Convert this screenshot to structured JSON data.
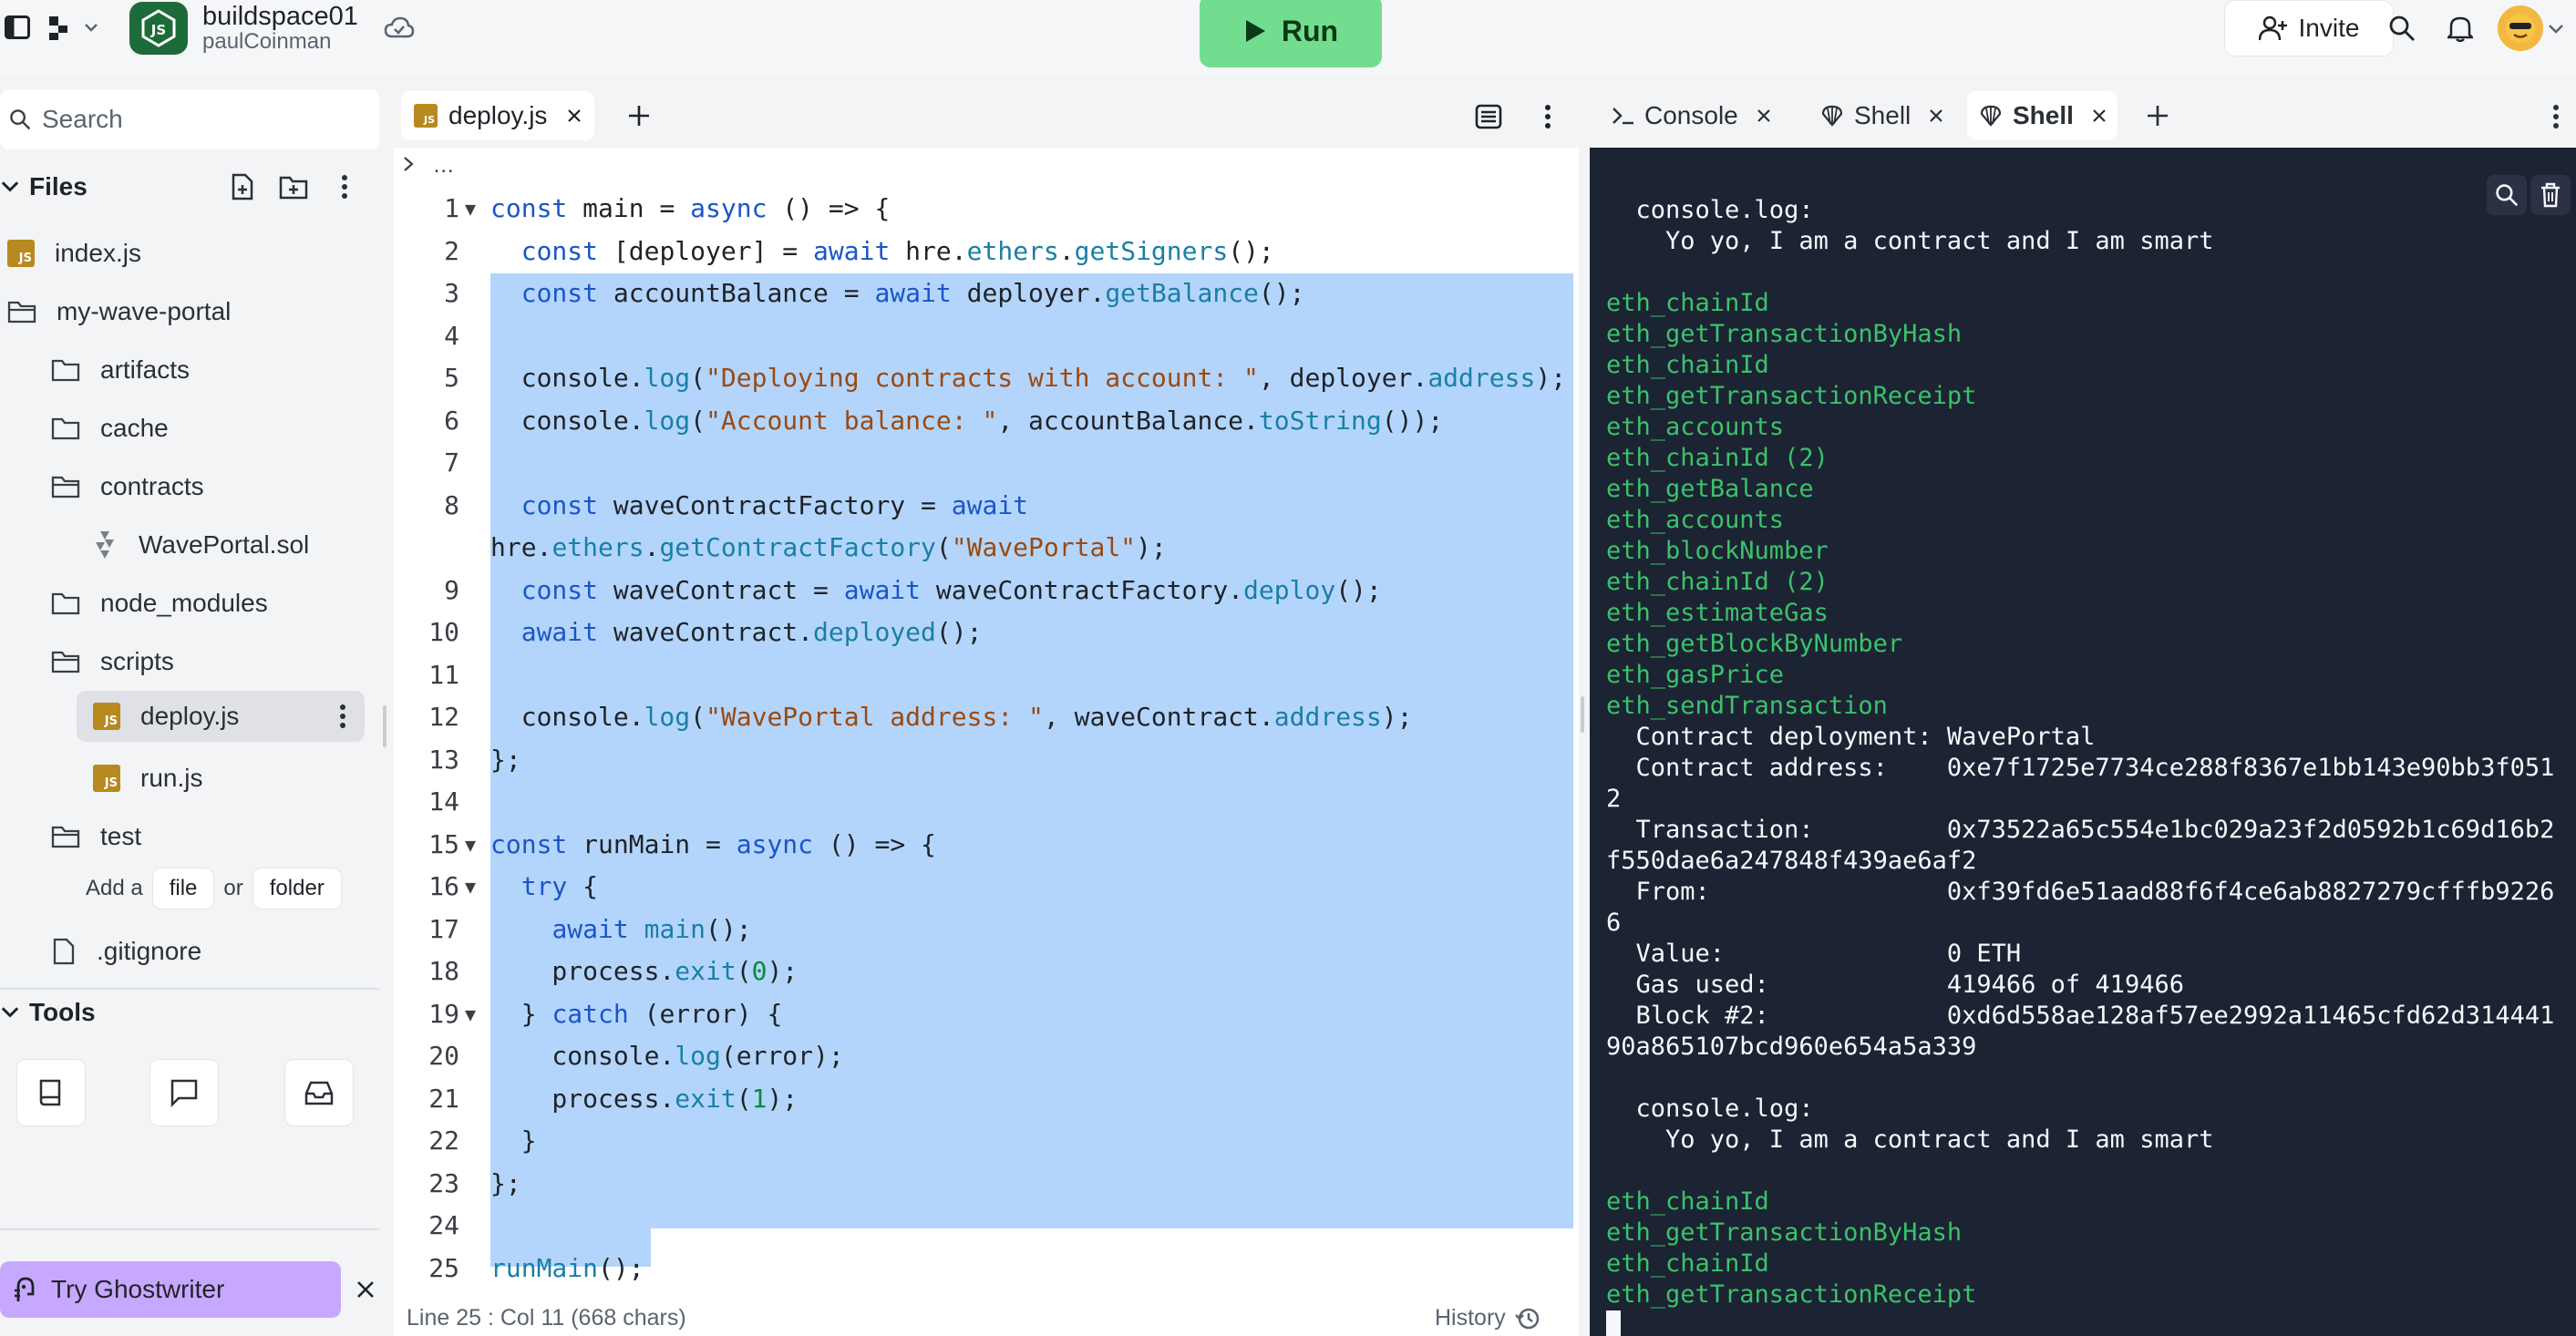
{
  "topbar": {
    "repl_name": "buildspace01",
    "owner": "paulCoinman",
    "run_label": "Run",
    "invite_label": "Invite"
  },
  "sidebar": {
    "search_placeholder": "Search",
    "files_label": "Files",
    "items": [
      {
        "label": "index.js",
        "type": "js"
      },
      {
        "label": "my-wave-portal",
        "type": "folder"
      },
      {
        "label": "artifacts",
        "type": "folder"
      },
      {
        "label": "cache",
        "type": "folder"
      },
      {
        "label": "contracts",
        "type": "folder"
      },
      {
        "label": "WavePortal.sol",
        "type": "sol"
      },
      {
        "label": "node_modules",
        "type": "folder"
      },
      {
        "label": "scripts",
        "type": "folder"
      },
      {
        "label": "deploy.js",
        "type": "js"
      },
      {
        "label": "run.js",
        "type": "js"
      },
      {
        "label": "test",
        "type": "folder"
      },
      {
        "label": ".gitignore",
        "type": "file"
      }
    ],
    "add_prefix": "Add a",
    "add_file": "file",
    "add_or": "or",
    "add_folder": "folder",
    "tools_label": "Tools",
    "ghostwriter_label": "Try Ghostwriter"
  },
  "editor": {
    "tab_label": "deploy.js",
    "breadcrumb": "…",
    "status_left": "Line 25 : Col 11 (668 chars)",
    "status_right": "History",
    "lines": [
      {
        "n": "1",
        "fold": "▼",
        "text": "const main = async () => {"
      },
      {
        "n": "2",
        "fold": "",
        "text": "  const [deployer] = await hre.ethers.getSigners();"
      },
      {
        "n": "3",
        "fold": "",
        "text": "  const accountBalance = await deployer.getBalance();"
      },
      {
        "n": "4",
        "fold": "",
        "text": ""
      },
      {
        "n": "5",
        "fold": "",
        "text": "  console.log(\"Deploying contracts with account: \", deployer.address);"
      },
      {
        "n": "6",
        "fold": "",
        "text": "  console.log(\"Account balance: \", accountBalance.toString());"
      },
      {
        "n": "7",
        "fold": "",
        "text": ""
      },
      {
        "n": "8",
        "fold": "",
        "text": "  const waveContractFactory = await"
      },
      {
        "n": "",
        "fold": "",
        "text": "hre.ethers.getContractFactory(\"WavePortal\");"
      },
      {
        "n": "9",
        "fold": "",
        "text": "  const waveContract = await waveContractFactory.deploy();"
      },
      {
        "n": "10",
        "fold": "",
        "text": "  await waveContract.deployed();"
      },
      {
        "n": "11",
        "fold": "",
        "text": ""
      },
      {
        "n": "12",
        "fold": "",
        "text": "  console.log(\"WavePortal address: \", waveContract.address);"
      },
      {
        "n": "13",
        "fold": "",
        "text": "};"
      },
      {
        "n": "14",
        "fold": "",
        "text": ""
      },
      {
        "n": "15",
        "fold": "▼",
        "text": "const runMain = async () => {"
      },
      {
        "n": "16",
        "fold": "▼",
        "text": "  try {"
      },
      {
        "n": "17",
        "fold": "",
        "text": "    await main();"
      },
      {
        "n": "18",
        "fold": "",
        "text": "    process.exit(0);"
      },
      {
        "n": "19",
        "fold": "▼",
        "text": "  } catch (error) {"
      },
      {
        "n": "20",
        "fold": "",
        "text": "    console.log(error);"
      },
      {
        "n": "21",
        "fold": "",
        "text": "    process.exit(1);"
      },
      {
        "n": "22",
        "fold": "",
        "text": "  }"
      },
      {
        "n": "23",
        "fold": "",
        "text": "};"
      },
      {
        "n": "24",
        "fold": "",
        "text": ""
      },
      {
        "n": "25",
        "fold": "",
        "text": "runMain();"
      }
    ]
  },
  "console": {
    "tabs": [
      {
        "label": "Console",
        "icon": "terminal-icon"
      },
      {
        "label": "Shell",
        "icon": "shell-icon"
      },
      {
        "label": "Shell",
        "icon": "shell-icon"
      }
    ],
    "output": [
      {
        "t": "  console.log:",
        "c": "w"
      },
      {
        "t": "    Yo yo, I am a contract and I am smart",
        "c": "w"
      },
      {
        "t": "",
        "c": "w"
      },
      {
        "t": "eth_chainId",
        "c": "g"
      },
      {
        "t": "eth_getTransactionByHash",
        "c": "g"
      },
      {
        "t": "eth_chainId",
        "c": "g"
      },
      {
        "t": "eth_getTransactionReceipt",
        "c": "g"
      },
      {
        "t": "eth_accounts",
        "c": "g"
      },
      {
        "t": "eth_chainId (2)",
        "c": "g"
      },
      {
        "t": "eth_getBalance",
        "c": "g"
      },
      {
        "t": "eth_accounts",
        "c": "g"
      },
      {
        "t": "eth_blockNumber",
        "c": "g"
      },
      {
        "t": "eth_chainId (2)",
        "c": "g"
      },
      {
        "t": "eth_estimateGas",
        "c": "g"
      },
      {
        "t": "eth_getBlockByNumber",
        "c": "g"
      },
      {
        "t": "eth_gasPrice",
        "c": "g"
      },
      {
        "t": "eth_sendTransaction",
        "c": "g"
      },
      {
        "t": "  Contract deployment: WavePortal",
        "c": "w"
      },
      {
        "t": "  Contract address:    0xe7f1725e7734ce288f8367e1bb143e90bb3f051",
        "c": "w"
      },
      {
        "t": "2",
        "c": "w"
      },
      {
        "t": "  Transaction:         0x73522a65c554e1bc029a23f2d0592b1c69d16b2",
        "c": "w"
      },
      {
        "t": "f550dae6a247848f439ae6af2",
        "c": "w"
      },
      {
        "t": "  From:                0xf39fd6e51aad88f6f4ce6ab8827279cfffb9226",
        "c": "w"
      },
      {
        "t": "6",
        "c": "w"
      },
      {
        "t": "  Value:               0 ETH",
        "c": "w"
      },
      {
        "t": "  Gas used:            419466 of 419466",
        "c": "w"
      },
      {
        "t": "  Block #2:            0xd6d558ae128af57ee2992a11465cfd62d314441",
        "c": "w"
      },
      {
        "t": "90a865107bcd960e654a5a339",
        "c": "w"
      },
      {
        "t": "",
        "c": "w"
      },
      {
        "t": "  console.log:",
        "c": "w"
      },
      {
        "t": "    Yo yo, I am a contract and I am smart",
        "c": "w"
      },
      {
        "t": "",
        "c": "w"
      },
      {
        "t": "eth_chainId",
        "c": "g"
      },
      {
        "t": "eth_getTransactionByHash",
        "c": "g"
      },
      {
        "t": "eth_chainId",
        "c": "g"
      },
      {
        "t": "eth_getTransactionReceipt",
        "c": "g"
      }
    ]
  },
  "colors": {
    "run": "#73dd8f",
    "selection": "#b4d5fb",
    "terminal_bg": "#1c2333",
    "terminal_green": "#3ac26b",
    "ghostwriter": "#c7a8ff"
  }
}
